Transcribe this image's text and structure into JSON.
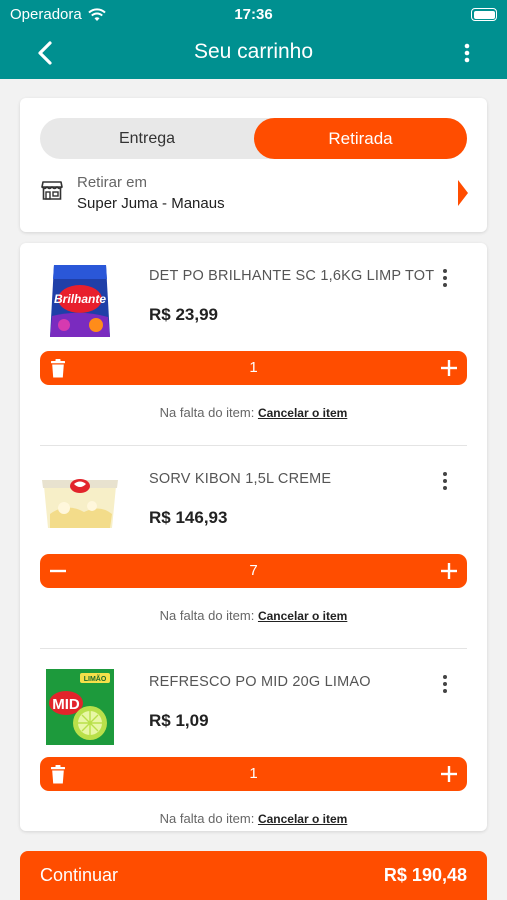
{
  "status_bar": {
    "carrier": "Operadora",
    "time": "17:36"
  },
  "header": {
    "title": "Seu carrinho"
  },
  "delivery": {
    "option_delivery": "Entrega",
    "option_pickup": "Retirada",
    "pickup_label": "Retirar em",
    "store_name": "Super Juma - Manaus"
  },
  "items": [
    {
      "name": "DET PO BRILHANTE SC 1,6KG LIMP TOT",
      "price": "R$ 23,99",
      "quantity": "1",
      "missing_label": "Na falta do item:",
      "missing_action": "Cancelar o item",
      "left_action_icon": "trash-icon"
    },
    {
      "name": "SORV KIBON 1,5L CREME",
      "price": "R$ 146,93",
      "quantity": "7",
      "missing_label": "Na falta do item:",
      "missing_action": "Cancelar o item",
      "left_action_icon": "minus-icon"
    },
    {
      "name": "REFRESCO PO MID 20G LIMAO",
      "price": "R$ 1,09",
      "quantity": "1",
      "missing_label": "Na falta do item:",
      "missing_action": "Cancelar o item",
      "left_action_icon": "trash-icon"
    }
  ],
  "footer": {
    "continue_label": "Continuar",
    "total": "R$ 190,48"
  },
  "colors": {
    "header_teal": "#009090",
    "accent_orange": "#ff4d00"
  }
}
